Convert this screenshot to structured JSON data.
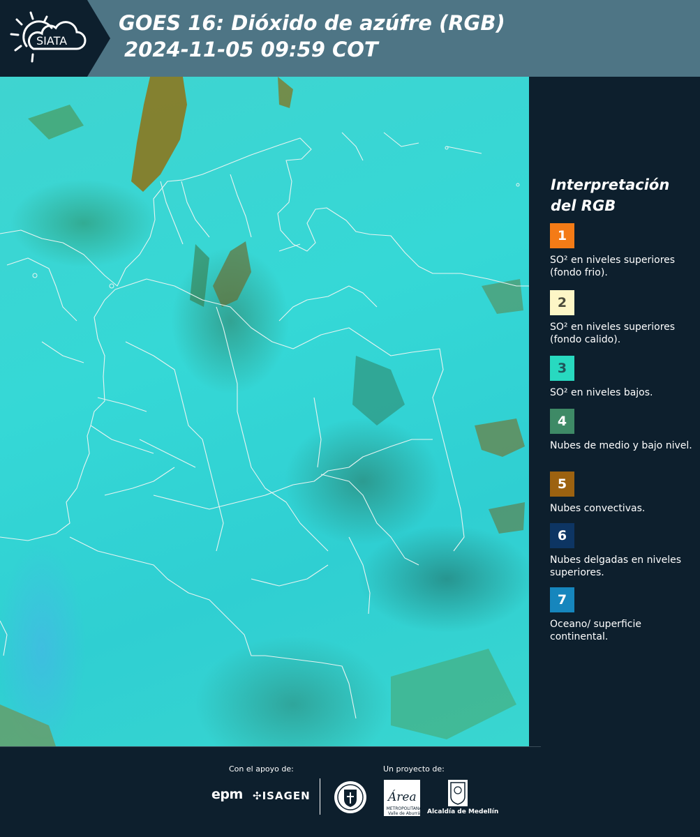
{
  "header": {
    "logo_text": "SIATA",
    "title_line1": "GOES 16: Dióxido de azúfre (RGB)",
    "title_line2": "2024-11-05 09:59 COT"
  },
  "legend": {
    "title": "Interpretación del RGB",
    "items": [
      {
        "number": "1",
        "label": "SO² en niveles superiores (fondo frio).",
        "color": "#f47b16",
        "text_color": "#ffffff"
      },
      {
        "number": "2",
        "label": "SO² en niveles superiores (fondo calido).",
        "color": "#fdf6c6",
        "text_color": "#4a4a3a"
      },
      {
        "number": "3",
        "label": "SO² en niveles bajos.",
        "color": "#28d9c0",
        "text_color": "#20555a"
      },
      {
        "number": "4",
        "label": "Nubes de medio y bajo nivel.",
        "color": "#3e8a66",
        "text_color": "#ffffff"
      },
      {
        "number": "5",
        "label": "Nubes convectivas.",
        "color": "#9c6210",
        "text_color": "#ffffff"
      },
      {
        "number": "6",
        "label": "Nubes delgadas en niveles superiores.",
        "color": "#0d3563",
        "text_color": "#ffffff"
      },
      {
        "number": "7",
        "label": "Oceano/ superficie continental.",
        "color": "#1686bd",
        "text_color": "#ffffff"
      }
    ]
  },
  "footer": {
    "support_label": "Con el apoyo de:",
    "project_label": "Un proyecto de:",
    "epm": "epm",
    "isagen": "ISAGEN",
    "area_text": "METROPOLITANA Valle de Aburrá",
    "area_script": "Área",
    "alcaldia": "Alcaldía de Medellín"
  }
}
